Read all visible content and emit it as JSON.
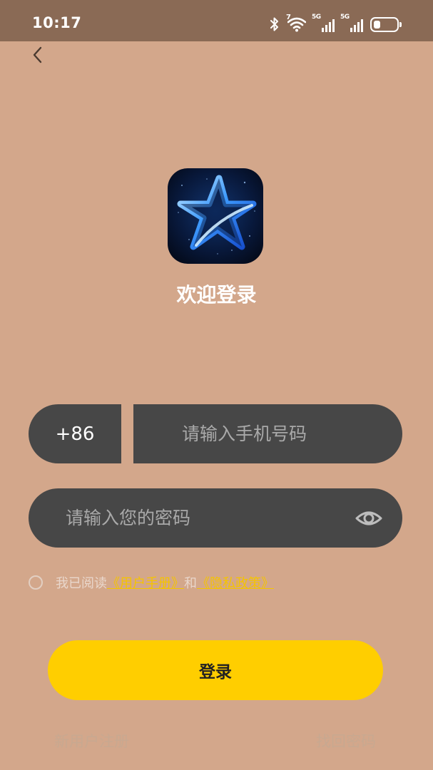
{
  "status_bar": {
    "time": "10:17",
    "wifi_label": "7",
    "network_1": "5G",
    "network_2": "5G",
    "icons": [
      "bluetooth-icon",
      "wifi-icon",
      "signal-icon",
      "signal-icon",
      "battery-icon"
    ]
  },
  "header": {
    "back_icon": "chevron-left-icon"
  },
  "app": {
    "logo_icon": "star-logo-icon",
    "welcome_title": "欢迎登录"
  },
  "form": {
    "country_code": "+86",
    "phone_placeholder": "请输入手机号码",
    "phone_value": "",
    "password_placeholder": "请输入您的密码",
    "password_value": "",
    "password_toggle_icon": "eye-icon"
  },
  "agreement": {
    "checked": false,
    "prefix": "我已阅读",
    "user_manual": "《用户手册》",
    "conjunction": "和",
    "privacy_policy": "《隐私政策》"
  },
  "actions": {
    "login_label": "登录",
    "register_label": "新用户注册",
    "forgot_label": "找回密码"
  },
  "colors": {
    "background": "#D3A78B",
    "status_bar": "#8A6A55",
    "input_bg": "#474747",
    "accent": "#FFCE00",
    "link": "#F5C400"
  }
}
